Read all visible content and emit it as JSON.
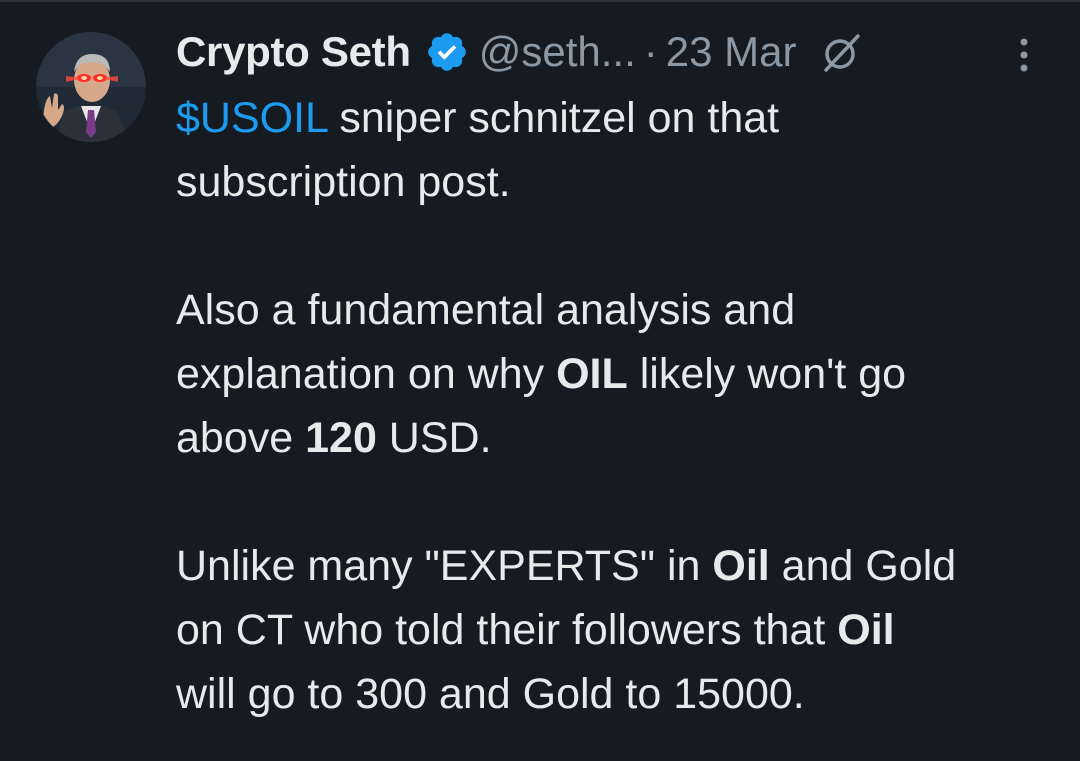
{
  "tweet": {
    "author": {
      "display_name": "Crypto Seth",
      "handle": "@seth...",
      "verified": true
    },
    "separator": "·",
    "date": "23 Mar",
    "paragraph1": {
      "cashtag": "$USOIL",
      "rest_line1": " sniper schnitzel on that",
      "line2": "subscription post."
    },
    "paragraph2": {
      "t1": "Also a fundamental analysis and",
      "t2": "explanation on why ",
      "b1": "OIL",
      "t3": " likely won't go",
      "t4": "above ",
      "b2": "120",
      "t5": " USD."
    },
    "paragraph3": {
      "t1": "Unlike many \"EXPERTS\" in ",
      "b1": "Oil",
      "t2": " and Gold",
      "t3": "on CT who told their followers that ",
      "b2": "Oil",
      "t4": "will go to 300 and Gold to 15000."
    }
  },
  "icons": {
    "verified": "verified-badge-icon",
    "grok": "grok-icon",
    "more": "more-vertical-icon"
  },
  "colors": {
    "background": "#161b22",
    "text": "#e7e9ea",
    "secondary_text": "#8b98a5",
    "accent": "#1d9bf0"
  }
}
